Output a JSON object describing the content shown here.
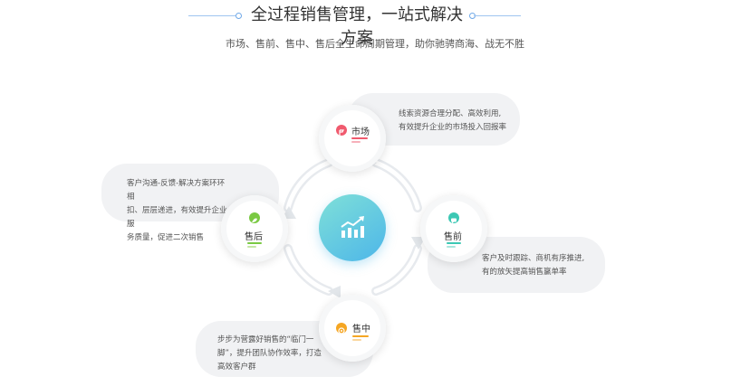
{
  "header": {
    "title": "全过程销售管理，一站式解决方案",
    "subtitle": "市场、售前、售中、售后全生命周期管理，助你驰骋商海、战无不胜"
  },
  "nodes": {
    "market": {
      "label": "市场",
      "color": "#f05a6e"
    },
    "presale": {
      "label": "售前",
      "color": "#3cc8b4"
    },
    "insale": {
      "label": "售中",
      "color": "#f5a623"
    },
    "aftersale": {
      "label": "售后",
      "color": "#7ac943"
    }
  },
  "descriptions": {
    "market": [
      "线索资源合理分配、高效利用,",
      "有效提升企业的市场投入回报率"
    ],
    "presale": [
      "客户及时跟踪、商机有序推进,",
      "有的放矢提高销售赢单率"
    ],
    "insale": [
      "步步为营露好销售的“临门一",
      "脚”，提升团队协作效率，打造",
      "高效客户群"
    ],
    "aftersale": [
      "客户沟通-反馈-解决方案环环相",
      "扣、层层递进，有效提升企业服",
      "务质量，促进二次销售"
    ]
  },
  "icons": {
    "center": "trend-chart-icon",
    "market": "flag-icon",
    "presale": "chat-icon",
    "insale": "smile-icon",
    "aftersale": "leaf-icon"
  },
  "colors": {
    "center_gradient_start": "#7fe0d8",
    "center_gradient_end": "#4db6e9",
    "accent_line": "#9fc5f0"
  }
}
